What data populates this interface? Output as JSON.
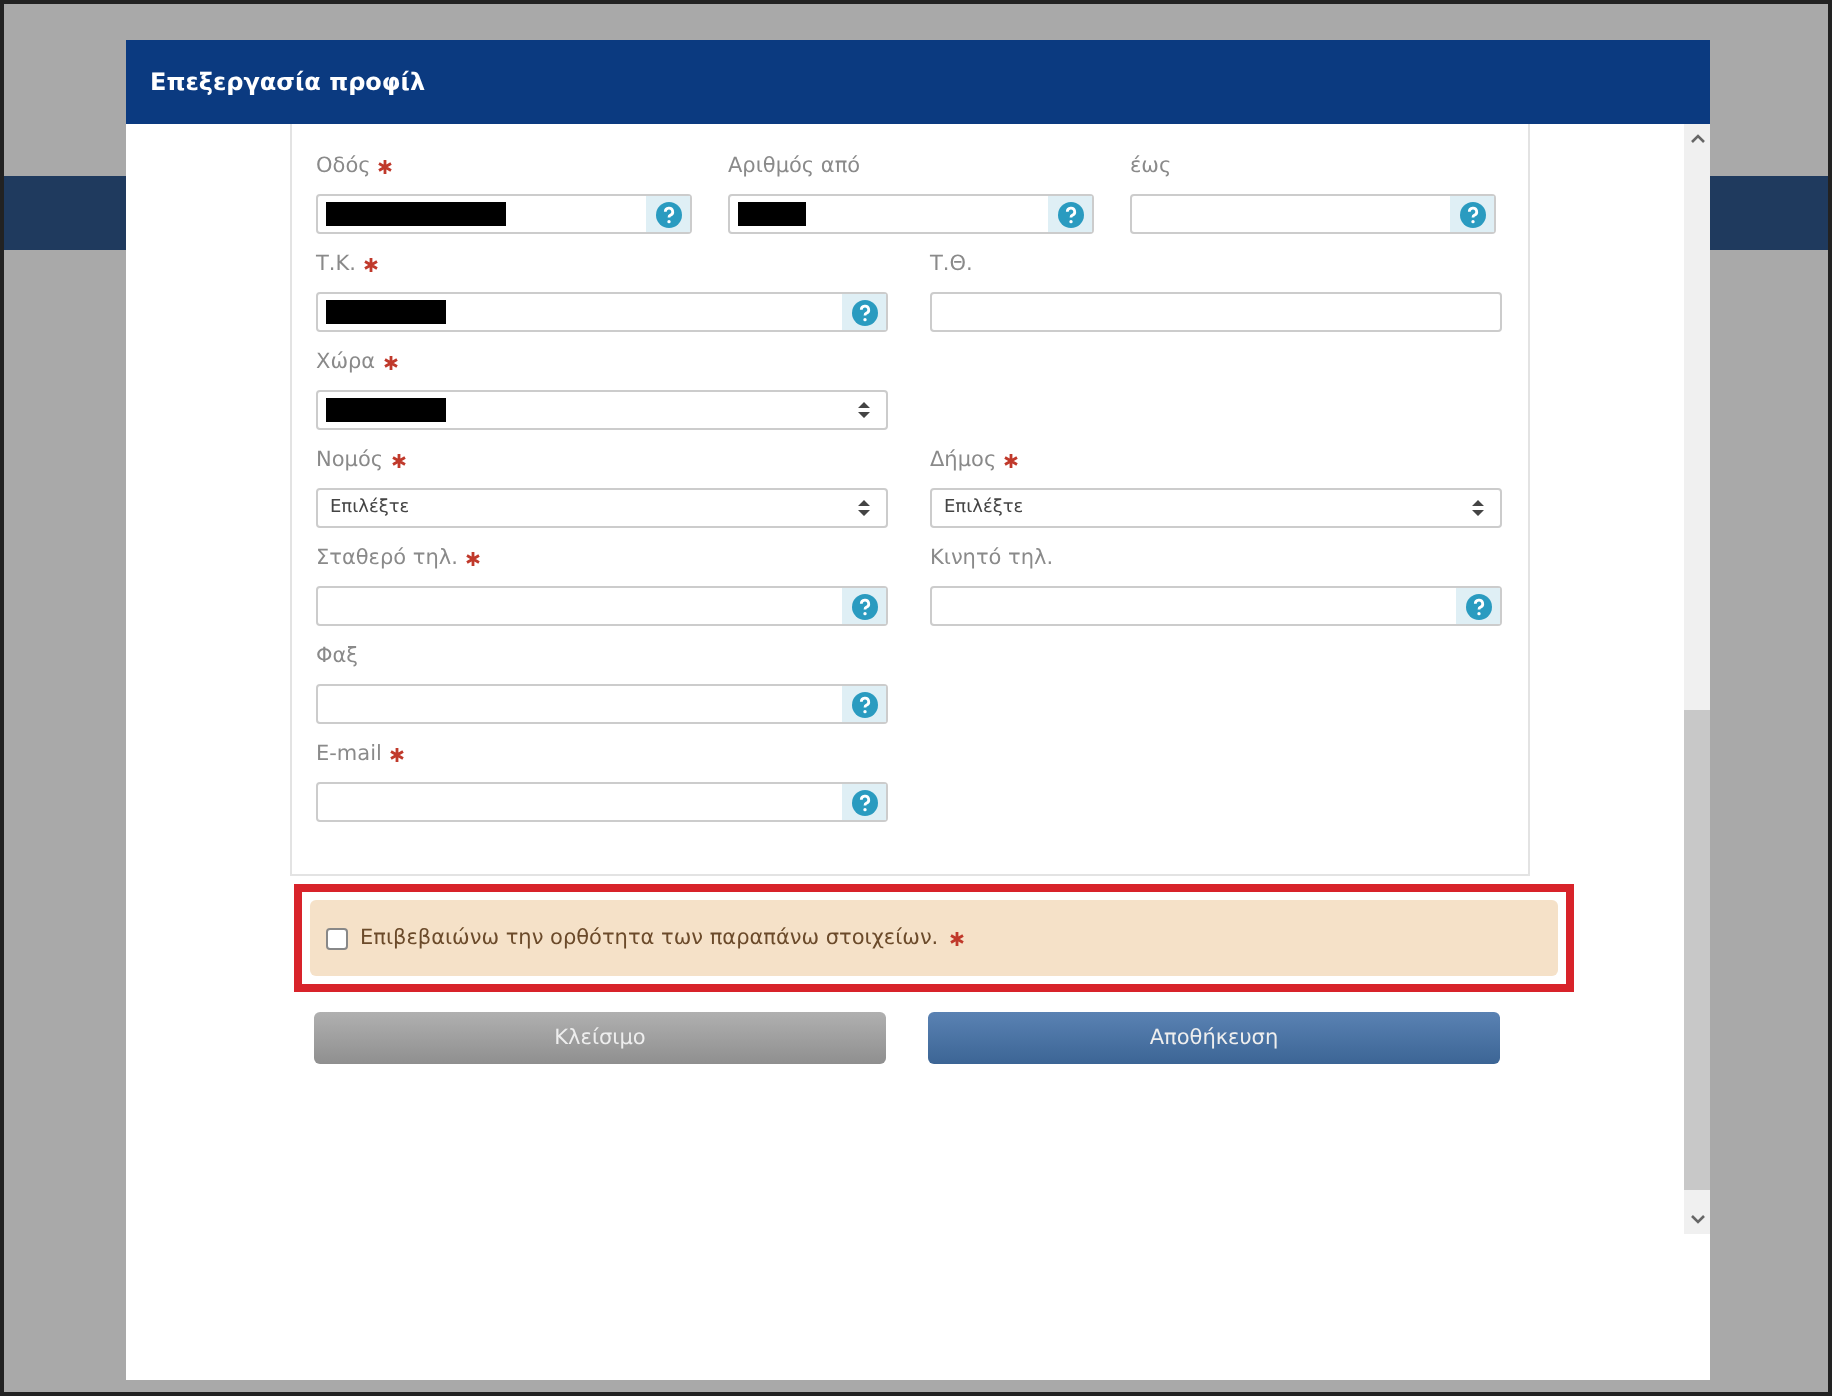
{
  "dialog": {
    "title": "Επεξεργασία προφίλ"
  },
  "form_rows": [
    {
      "fields": [
        {
          "label": "Οδός",
          "required": true,
          "kind": "text",
          "redacted": true,
          "help": true
        },
        {
          "label": "Αριθμός από",
          "required": false,
          "kind": "text",
          "redacted": true,
          "help": true
        },
        {
          "label": "έως",
          "required": false,
          "kind": "text",
          "redacted": false,
          "help": true
        }
      ]
    },
    {
      "fields": [
        {
          "label": "Τ.Κ.",
          "required": true,
          "kind": "text",
          "redacted": true,
          "help": true
        },
        {
          "label": "Τ.Θ.",
          "required": false,
          "kind": "text",
          "redacted": false,
          "help": false
        }
      ]
    },
    {
      "fields": [
        {
          "label": "Χώρα",
          "required": true,
          "kind": "select",
          "redacted": true,
          "help": false
        }
      ]
    },
    {
      "fields": [
        {
          "label": "Νομός",
          "required": true,
          "kind": "select",
          "redacted": false,
          "value": "Επιλέξτε",
          "help": false
        },
        {
          "label": "Δήμος",
          "required": true,
          "kind": "select",
          "redacted": false,
          "value": "Επιλέξτε",
          "help": false
        }
      ]
    },
    {
      "fields": [
        {
          "label": "Σταθερό τηλ.",
          "required": true,
          "kind": "text",
          "redacted": false,
          "help": true
        },
        {
          "label": "Κινητό τηλ.",
          "required": false,
          "kind": "text",
          "redacted": false,
          "help": true
        }
      ]
    },
    {
      "fields": [
        {
          "label": "Φαξ",
          "required": false,
          "kind": "text",
          "redacted": false,
          "help": true
        }
      ]
    },
    {
      "fields": [
        {
          "label": "E-mail",
          "required": true,
          "kind": "text",
          "redacted": false,
          "help": true
        }
      ]
    }
  ],
  "confirmation": {
    "label": "Επιβεβαιώνω την ορθότητα των παραπάνω στοιχείων.",
    "checked": false,
    "required": true,
    "highlighted": true
  },
  "buttons": [
    {
      "label": "Κλείσιμο",
      "kind": "secondary"
    },
    {
      "label": "Αποθήκευση",
      "kind": "primary"
    }
  ]
}
